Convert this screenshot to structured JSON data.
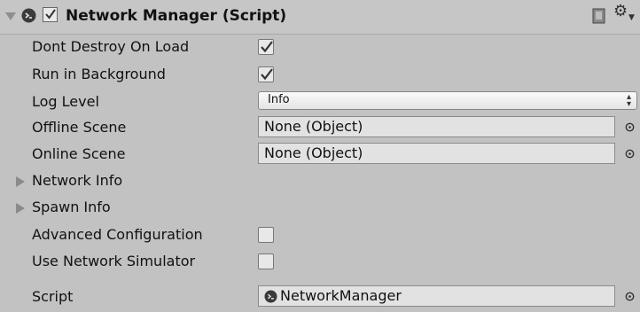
{
  "component": {
    "title": "Network Manager (Script)"
  },
  "fields": {
    "dont_destroy": {
      "label": "Dont Destroy On Load",
      "checked": true
    },
    "run_background": {
      "label": "Run in Background",
      "checked": true
    },
    "log_level": {
      "label": "Log Level",
      "value": "Info"
    },
    "offline_scene": {
      "label": "Offline Scene",
      "value": "None (Object)"
    },
    "online_scene": {
      "label": "Online Scene",
      "value": "None (Object)"
    },
    "network_info": {
      "label": "Network Info"
    },
    "spawn_info": {
      "label": "Spawn Info"
    },
    "advanced_config": {
      "label": "Advanced Configuration",
      "checked": false
    },
    "network_simulator": {
      "label": "Use Network Simulator",
      "checked": false
    },
    "script": {
      "label": "Script",
      "value": "NetworkManager"
    }
  },
  "icons": {
    "header": [
      "fold-triangle-icon",
      "script-icon",
      "checkbox-check-icon",
      "help-book-icon",
      "gear-icon"
    ],
    "fields": [
      "object-picker-icon",
      "foldout-arrow-icon",
      "checkmark-icon"
    ]
  },
  "colors": {
    "panel_bg": "#c2c2c2",
    "field_bg": "#e2e2e2",
    "border": "#8a8a8a"
  }
}
